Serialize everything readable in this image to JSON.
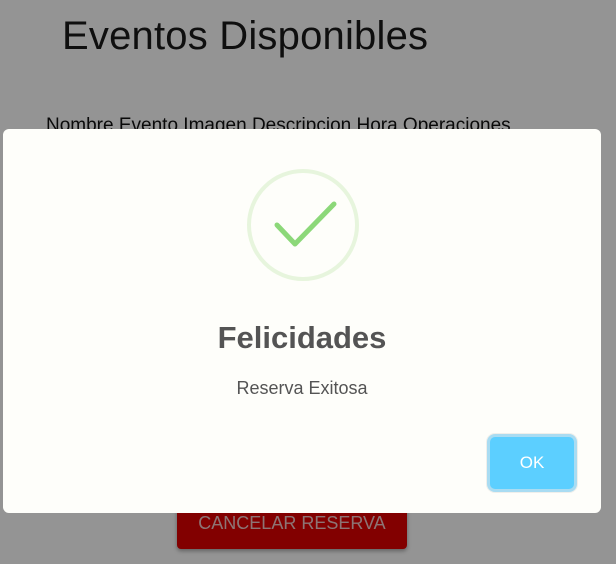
{
  "page": {
    "title": "Eventos Disponibles",
    "table_header": "Nombre Evento Imagen Descripcion Hora Operaciones",
    "cancel_button_label": "CANCELAR RESERVA"
  },
  "modal": {
    "icon": "success-check",
    "title": "Felicidades",
    "text": "Reserva Exitosa",
    "ok_label": "OK"
  },
  "colors": {
    "overlay": "#979797",
    "modal_bg": "#fefefa",
    "check": "#8cd879",
    "ok_button": "#5ccfff",
    "cancel_button": "#e00000"
  }
}
